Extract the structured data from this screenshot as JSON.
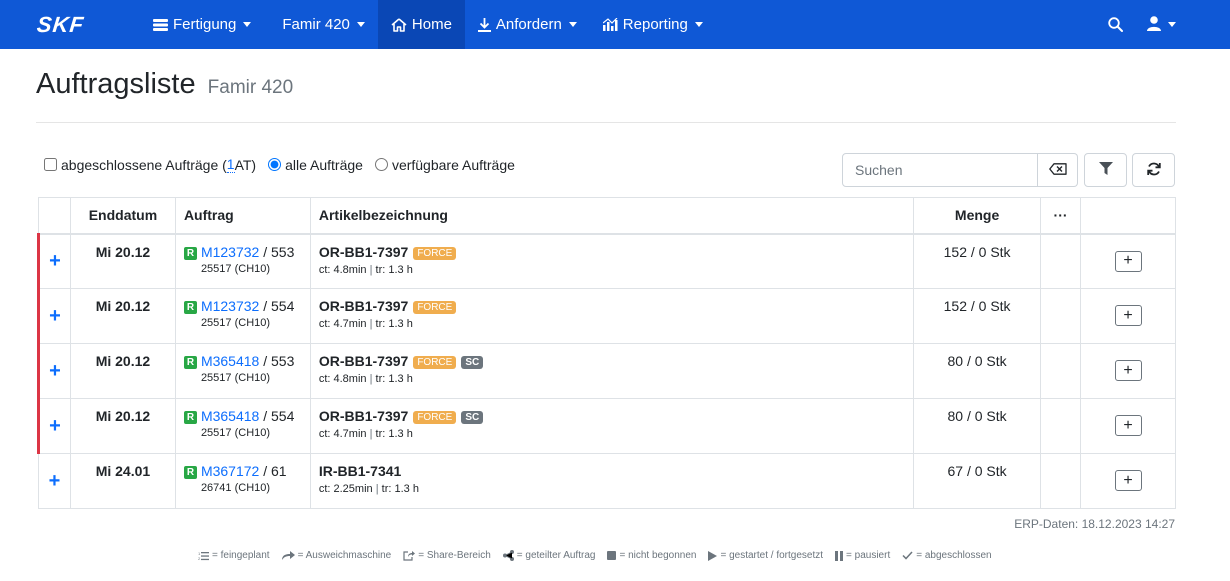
{
  "navbar": {
    "brand": "SKF",
    "items": [
      {
        "label": "Fertigung",
        "icon": "list-icon",
        "caret": true
      },
      {
        "label": "Famir 420",
        "icon": "",
        "caret": true
      },
      {
        "label": "Home",
        "icon": "home-icon",
        "caret": false
      },
      {
        "label": "Anfordern",
        "icon": "download-icon",
        "caret": true
      },
      {
        "label": "Reporting",
        "icon": "chart-icon",
        "caret": true
      }
    ],
    "active": "Home"
  },
  "header": {
    "title": "Auftragsliste",
    "subtitle": "Famir 420"
  },
  "filters": {
    "completed_label": "abgeschlossene Aufträge (",
    "completed_count": "1",
    "completed_suffix": " AT)",
    "all_label": "alle Aufträge",
    "available_label": "verfügbare Aufträge",
    "selected": "all"
  },
  "search": {
    "placeholder": "Suchen"
  },
  "table": {
    "headers": {
      "date": "Enddatum",
      "order": "Auftrag",
      "article": "Artikelbezeichnung",
      "qty": "Menge",
      "more": "···"
    },
    "rows": [
      {
        "date": "Mi 20.12",
        "order": "M123732",
        "op": " / 553",
        "ref": "25517 (CH10)",
        "article": "OR-BB1-7397",
        "force": "FORCE",
        "sc": "",
        "ct": "ct: 4.8min",
        "tr": "tr: 1.3 h",
        "qty": "152 / 0 Stk",
        "urgent": true
      },
      {
        "date": "Mi 20.12",
        "order": "M123732",
        "op": " / 554",
        "ref": "25517 (CH10)",
        "article": "OR-BB1-7397",
        "force": "FORCE",
        "sc": "",
        "ct": "ct: 4.7min",
        "tr": "tr: 1.3 h",
        "qty": "152 / 0 Stk",
        "urgent": true
      },
      {
        "date": "Mi 20.12",
        "order": "M365418",
        "op": " / 553",
        "ref": "25517 (CH10)",
        "article": "OR-BB1-7397",
        "force": "FORCE",
        "sc": "SC",
        "ct": "ct: 4.8min",
        "tr": "tr: 1.3 h",
        "qty": "80 / 0 Stk",
        "urgent": true
      },
      {
        "date": "Mi 20.12",
        "order": "M365418",
        "op": " / 554",
        "ref": "25517 (CH10)",
        "article": "OR-BB1-7397",
        "force": "FORCE",
        "sc": "SC",
        "ct": "ct: 4.7min",
        "tr": "tr: 1.3 h",
        "qty": "80 / 0 Stk",
        "urgent": true
      },
      {
        "date": "Mi 24.01",
        "order": "M367172",
        "op": " / 61",
        "ref": "26741 (CH10)",
        "article": "IR-BB1-7341",
        "force": "",
        "sc": "",
        "ct": "ct: 2.25min",
        "tr": "tr: 1.3 h",
        "qty": "67 / 0 Stk",
        "urgent": false
      }
    ]
  },
  "erp": "ERP-Daten: 18.12.2023 14:27",
  "legend": [
    {
      "icon": "list-ordered-icon",
      "label": "= feingeplant"
    },
    {
      "icon": "share-arrow-icon",
      "label": "= Ausweichmaschine"
    },
    {
      "icon": "share-square-icon",
      "label": "= Share-Bereich"
    },
    {
      "icon": "share-nodes-icon",
      "label": "= geteilter Auftrag"
    },
    {
      "icon": "stop-icon",
      "label": "= nicht begonnen"
    },
    {
      "icon": "play-icon",
      "label": "= gestartet / fortgesetzt"
    },
    {
      "icon": "pause-icon",
      "label": "= pausiert"
    },
    {
      "icon": "check-icon",
      "label": "= abgeschlossen"
    }
  ]
}
